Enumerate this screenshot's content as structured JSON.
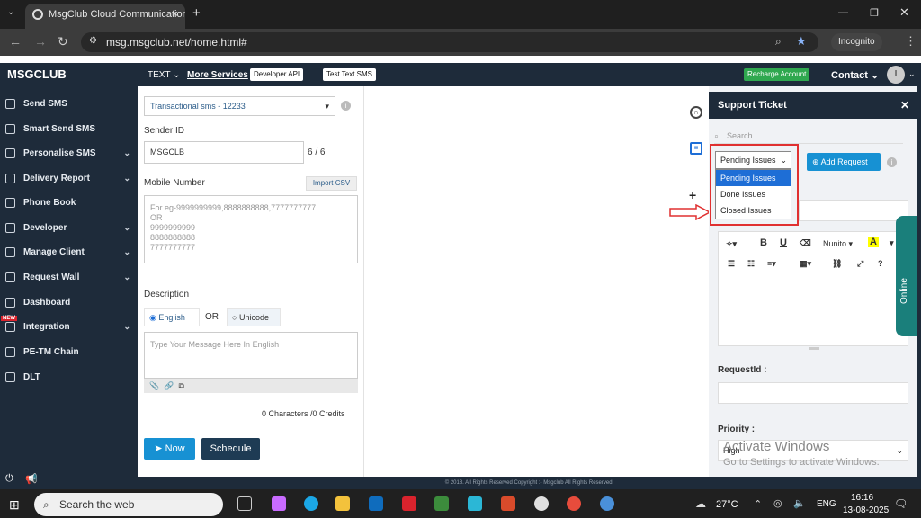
{
  "browser": {
    "tab_title": "MsgClub Cloud Communication",
    "url": "msg.msgclub.net/home.html#",
    "incognito": "Incognito"
  },
  "header": {
    "logo": "MSGCLUB",
    "text_menu": "TEXT",
    "more_services": "More Services",
    "developer_api": "Developer API",
    "test_text_sms": "Test Text SMS",
    "recharge": "Recharge Account",
    "contact": "Contact",
    "avatar": "I"
  },
  "sidebar": {
    "items": [
      {
        "label": "Send SMS",
        "chev": ""
      },
      {
        "label": "Smart Send SMS",
        "chev": ""
      },
      {
        "label": "Personalise SMS",
        "chev": "⌄"
      },
      {
        "label": "Delivery Report",
        "chev": "⌄"
      },
      {
        "label": "Phone Book",
        "chev": ""
      },
      {
        "label": "Developer",
        "chev": "⌄"
      },
      {
        "label": "Manage Client",
        "chev": "⌄"
      },
      {
        "label": "Request Wall",
        "chev": "⌄"
      },
      {
        "label": "Dashboard",
        "chev": ""
      },
      {
        "label": "Integration",
        "chev": "⌄"
      },
      {
        "label": "PE-TM Chain",
        "chev": ""
      },
      {
        "label": "DLT",
        "chev": ""
      }
    ],
    "new_badge": "NEW"
  },
  "form": {
    "route_select": "Transactional sms - 12233",
    "sender_id_label": "Sender ID",
    "sender_id_value": "MSGCLB",
    "sender_count": "6 / 6",
    "mobile_label": "Mobile Number",
    "import_csv": "Import CSV",
    "mobile_placeholder": [
      "For eg-9999999999,8888888888,7777777777",
      "OR",
      "9999999999",
      "8888888888",
      "7777777777"
    ],
    "description_label": "Description",
    "english": "English",
    "or": "OR",
    "unicode": "Unicode",
    "message_placeholder": "Type Your Message Here In English",
    "counter": "0 Characters /0 Credits",
    "now_button": "Now",
    "schedule_button": "Schedule"
  },
  "support": {
    "title": "Support Ticket",
    "search_placeholder": "Search",
    "selected": "Pending Issues",
    "options": [
      "Pending Issues",
      "Done Issues",
      "Closed Issues"
    ],
    "add_request": "Add Request",
    "font": "Nunito",
    "request_id_label": "RequestId :",
    "priority_label": "Priority :",
    "priority_value": "High",
    "online": "Online"
  },
  "footer": {
    "text": "© 2018. All Rights Reserved Copyright :- Msgclub All Rights Reserved."
  },
  "watermark": {
    "line1": "Activate Windows",
    "line2": "Go to Settings to activate Windows."
  },
  "taskbar": {
    "search": "Search the web",
    "temp": "27°C",
    "lang": "ENG",
    "time": "16:16",
    "date": "13-08-2025"
  }
}
